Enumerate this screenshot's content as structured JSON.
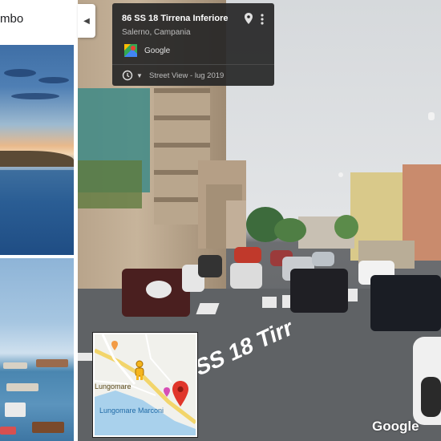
{
  "search": {
    "query_fragment": "mbo"
  },
  "location_card": {
    "title": "86 SS 18 Tirrena Inferiore",
    "subtitle": "Salerno, Campania",
    "provider_label": "Google",
    "imagery_date": "Street View - lug 2019"
  },
  "street": {
    "road_text": "SS 18 Tirr",
    "watermark": "Google"
  },
  "minimap": {
    "place_labels": [
      "Lungomare",
      "Lungomare Marconi"
    ]
  },
  "colors": {
    "accent_blue": "#2f7de1",
    "marker_red": "#e0362b",
    "card_bg": "#262626",
    "road_line": "#f2d56b"
  },
  "icons": [
    "collapse-chevron-icon",
    "map-pin-icon",
    "more-vert-icon",
    "google-maps-icon",
    "history-clock-icon",
    "dropdown-caret-icon",
    "pegman-icon",
    "location-marker-icon"
  ]
}
